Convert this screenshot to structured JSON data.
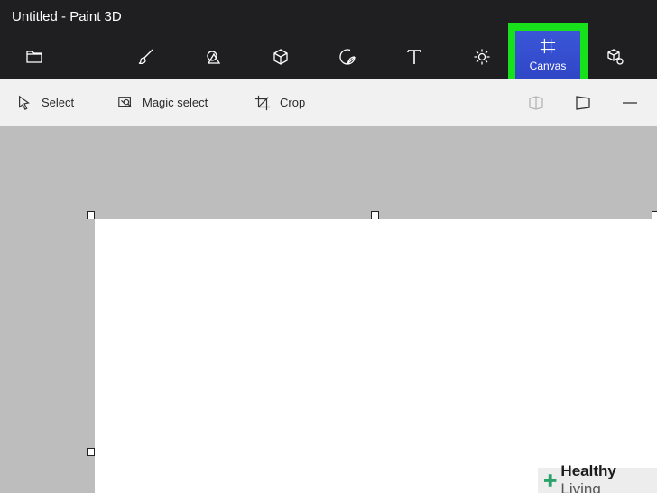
{
  "window": {
    "title": "Untitled - Paint 3D"
  },
  "toolbar": {
    "items": [
      {
        "icon": "folder-icon"
      },
      {
        "icon": "brush-icon"
      },
      {
        "icon": "2d-shapes-icon"
      },
      {
        "icon": "3d-shapes-icon"
      },
      {
        "icon": "stickers-icon"
      },
      {
        "icon": "text-icon"
      },
      {
        "icon": "effects-icon"
      },
      {
        "icon": "canvas-icon",
        "label": "Canvas",
        "selected": true
      },
      {
        "icon": "3d-library-icon"
      }
    ],
    "highlight_color": "#16e11a",
    "selected_tab_color": "#3a57d8"
  },
  "subtoolbar": {
    "select": "Select",
    "magic_select": "Magic select",
    "crop": "Crop"
  },
  "watermark": {
    "brand": "Healthy",
    "suffix": "Living"
  }
}
